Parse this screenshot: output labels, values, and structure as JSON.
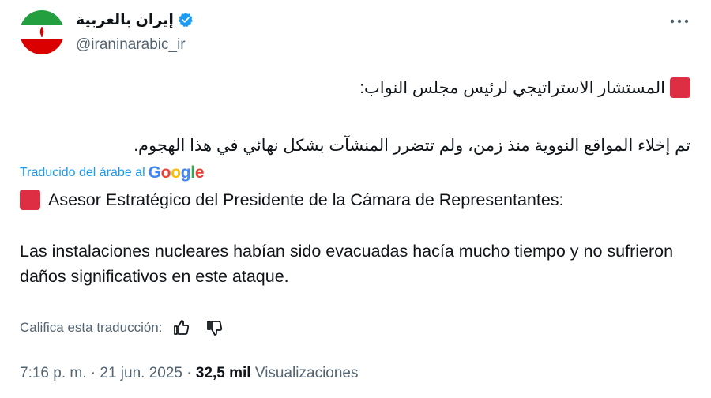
{
  "author": {
    "display_name": "إيران بالعربية",
    "handle": "@iraninarabic_ir"
  },
  "icons": {
    "avatar": "iran-flag",
    "verified": "verified-badge-icon",
    "more": "more-options-icon",
    "emoji_square": "red-square-emoji",
    "thumbs_up": "thumbs-up-icon",
    "thumbs_down": "thumbs-down-icon"
  },
  "tweet": {
    "arabic_line1": "المستشار الاستراتيجي لرئيس مجلس النواب:",
    "arabic_line2": "تم إخلاء المواقع النووية منذ زمن، ولم تتضرر المنشآت بشكل نهائي في هذا الهجوم."
  },
  "translation": {
    "label": "Traducido del árabe al",
    "provider": "Google",
    "line1": "Asesor Estratégico del Presidente de la Cámara de Representantes:",
    "body": "Las instalaciones nucleares habían sido evacuadas hacía mucho tiempo y no sufrieron daños significativos en este ataque.",
    "rate_prompt": "Califica esta traducción:"
  },
  "meta": {
    "time": "7:16 p. m.",
    "date": "21 jun. 2025",
    "views_count": "32,5 mil",
    "views_label": "Visualizaciones"
  },
  "colors": {
    "accent": "#1d9bf0",
    "secondary_text": "#536471",
    "red_square": "#dd2e44"
  }
}
